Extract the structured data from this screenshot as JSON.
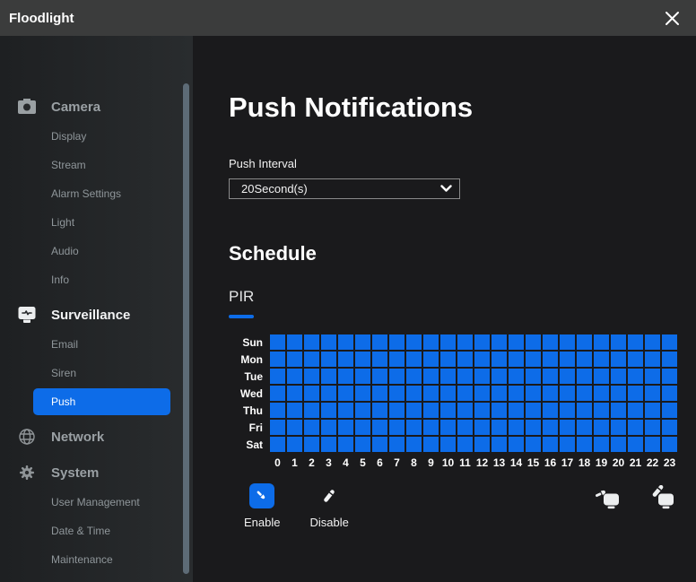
{
  "colors": {
    "accent": "#0d6ce8",
    "icon_gray": "#8f9497",
    "icon_white": "#eceeef"
  },
  "titlebar": {
    "title": "Floodlight",
    "close_icon": "close-icon"
  },
  "sidebar": {
    "active_item": "Push",
    "sections": [
      {
        "label": "Camera",
        "icon": "camera-icon",
        "items": [
          "Display",
          "Stream",
          "Alarm Settings",
          "Light",
          "Audio",
          "Info"
        ]
      },
      {
        "label": "Surveillance",
        "icon": "monitor-icon",
        "items": [
          "Email",
          "Siren",
          "Push"
        ]
      },
      {
        "label": "Network",
        "icon": "globe-icon",
        "items": []
      },
      {
        "label": "System",
        "icon": "gear-icon",
        "items": [
          "User Management",
          "Date & Time",
          "Maintenance"
        ]
      }
    ]
  },
  "main": {
    "title": "Push Notifications",
    "push_interval": {
      "label": "Push Interval",
      "value": "20Second(s)",
      "chevron_icon": "chevron-down-icon"
    },
    "schedule": {
      "title": "Schedule",
      "tab": "PIR",
      "days": [
        "Sun",
        "Mon",
        "Tue",
        "Wed",
        "Thu",
        "Fri",
        "Sat"
      ],
      "hours": [
        "0",
        "1",
        "2",
        "3",
        "4",
        "5",
        "6",
        "7",
        "8",
        "9",
        "10",
        "11",
        "12",
        "13",
        "14",
        "15",
        "16",
        "17",
        "18",
        "19",
        "20",
        "21",
        "22",
        "23"
      ],
      "all_cells_selected": true
    },
    "actions": {
      "enable_label": "Enable",
      "enable_icon": "brush-icon",
      "enable_selected": true,
      "disable_label": "Disable",
      "disable_icon": "eraser-icon",
      "fill_all_icon": "brush-fill-all-icon",
      "clear_all_icon": "eraser-clear-all-icon"
    }
  }
}
